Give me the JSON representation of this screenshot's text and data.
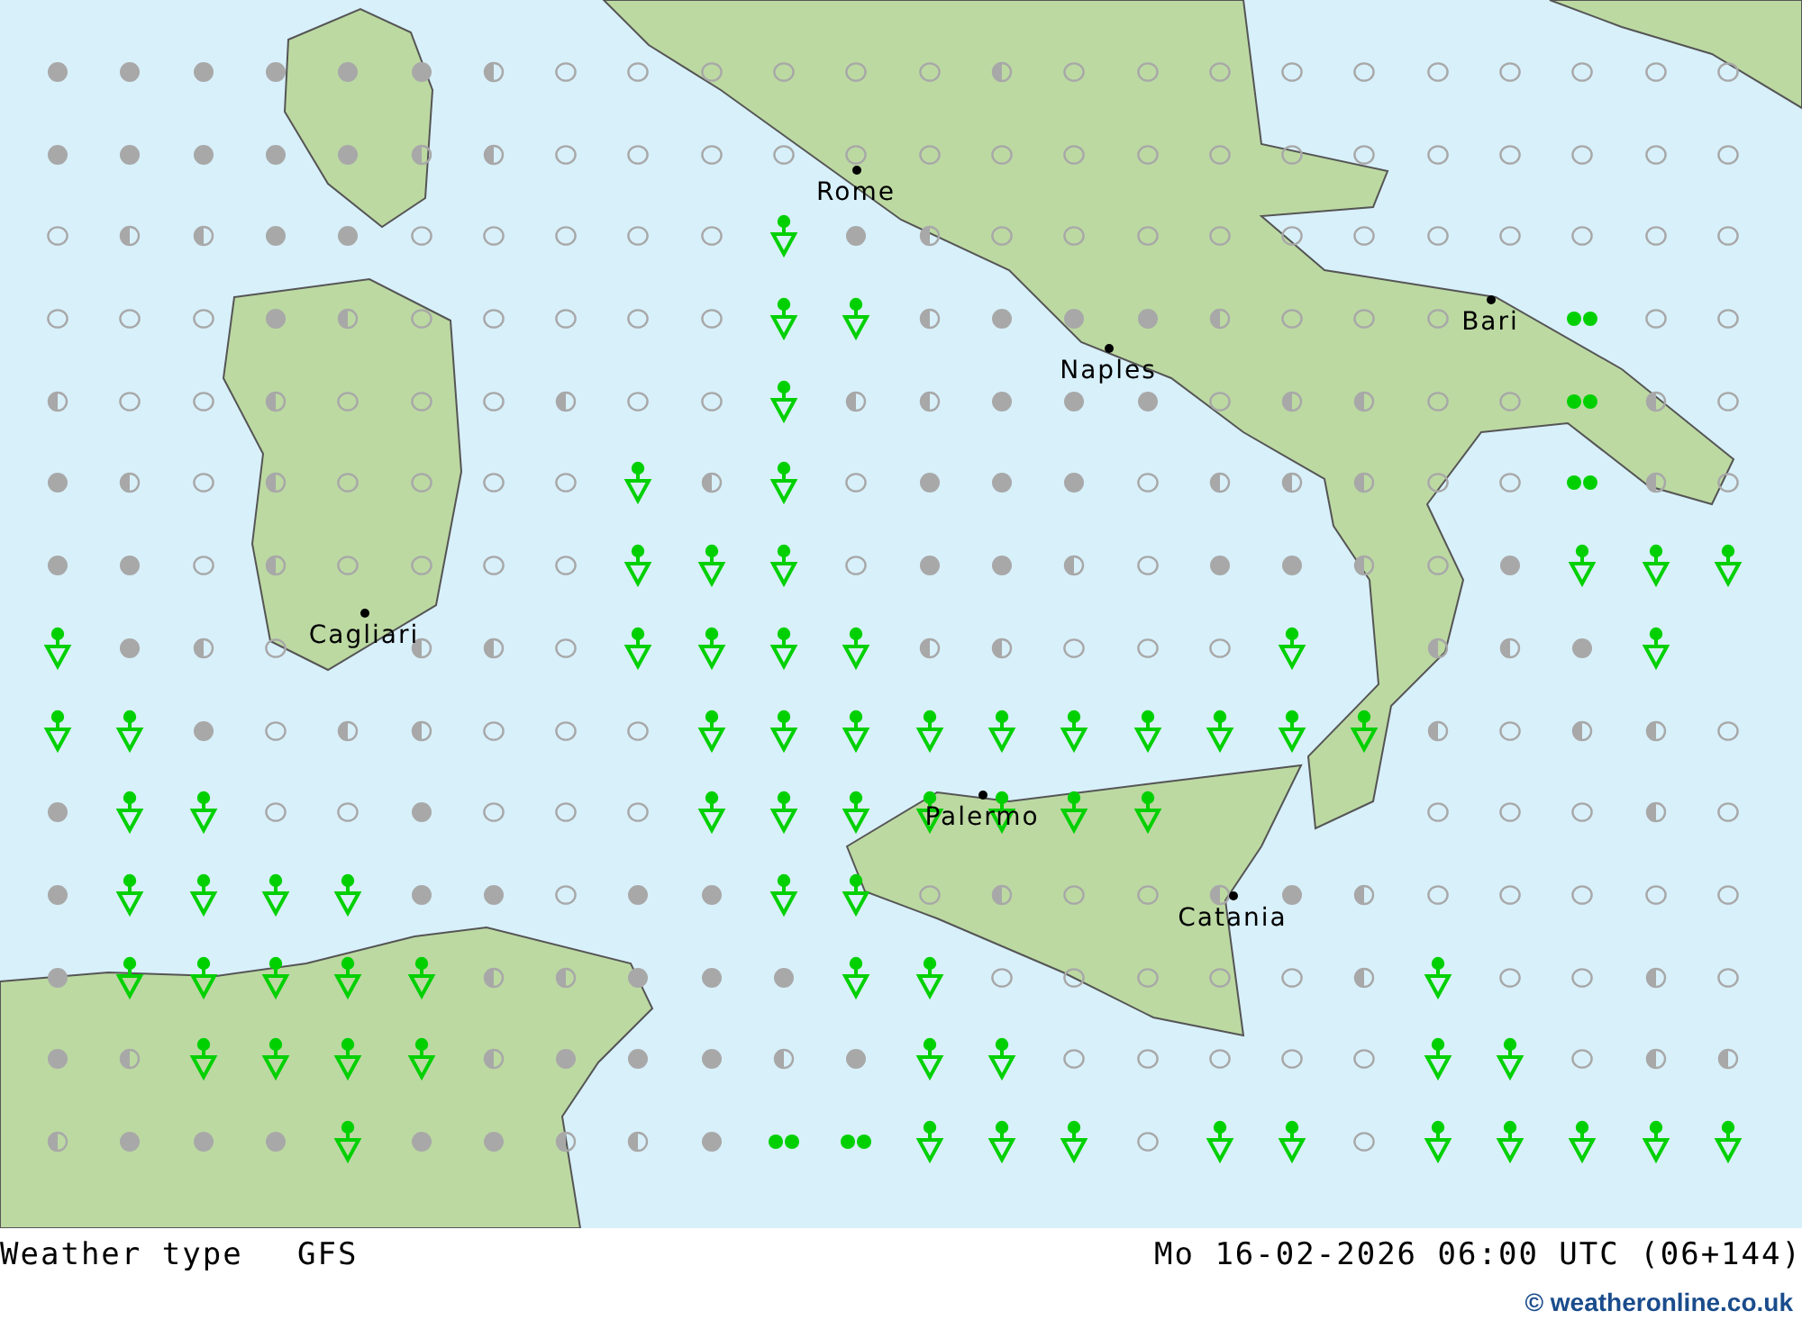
{
  "map": {
    "cities": [
      {
        "name": "Rome"
      },
      {
        "name": "Naples"
      },
      {
        "name": "Bari"
      },
      {
        "name": "Cagliari"
      },
      {
        "name": "Palermo"
      },
      {
        "name": "Catania"
      }
    ]
  },
  "weather_grid": {
    "rows": [
      {
        "cells": [
          {
            "kind": "full"
          },
          {
            "kind": "full"
          },
          {
            "kind": "full"
          },
          {
            "kind": "full"
          },
          {
            "kind": "full"
          },
          {
            "kind": "full"
          },
          {
            "kind": "half"
          },
          {
            "kind": "empty"
          },
          {
            "kind": "empty"
          },
          {
            "kind": "empty"
          },
          {
            "kind": "empty"
          },
          {
            "kind": "empty"
          },
          {
            "kind": "empty"
          },
          {
            "kind": "half"
          },
          {
            "kind": "empty"
          },
          {
            "kind": "empty"
          },
          {
            "kind": "empty"
          },
          {
            "kind": "empty"
          },
          {
            "kind": "empty"
          },
          {
            "kind": "empty"
          },
          {
            "kind": "empty"
          },
          {
            "kind": "empty"
          },
          {
            "kind": "empty"
          },
          {
            "kind": "empty"
          }
        ]
      },
      {
        "cells": [
          {
            "kind": "full"
          },
          {
            "kind": "full"
          },
          {
            "kind": "full"
          },
          {
            "kind": "full"
          },
          {
            "kind": "full"
          },
          {
            "kind": "half"
          },
          {
            "kind": "half"
          },
          {
            "kind": "empty"
          },
          {
            "kind": "empty"
          },
          {
            "kind": "empty"
          },
          {
            "kind": "empty"
          },
          {
            "kind": "empty"
          },
          {
            "kind": "empty"
          },
          {
            "kind": "empty"
          },
          {
            "kind": "empty"
          },
          {
            "kind": "empty"
          },
          {
            "kind": "empty"
          },
          {
            "kind": "empty"
          },
          {
            "kind": "empty"
          },
          {
            "kind": "empty"
          },
          {
            "kind": "empty"
          },
          {
            "kind": "empty"
          },
          {
            "kind": "empty"
          },
          {
            "kind": "empty"
          }
        ]
      },
      {
        "cells": [
          {
            "kind": "empty"
          },
          {
            "kind": "half"
          },
          {
            "kind": "half"
          },
          {
            "kind": "full"
          },
          {
            "kind": "full"
          },
          {
            "kind": "empty"
          },
          {
            "kind": "empty"
          },
          {
            "kind": "empty"
          },
          {
            "kind": "empty"
          },
          {
            "kind": "empty"
          },
          {
            "kind": "shower"
          },
          {
            "kind": "full"
          },
          {
            "kind": "half"
          },
          {
            "kind": "empty"
          },
          {
            "kind": "empty"
          },
          {
            "kind": "empty"
          },
          {
            "kind": "empty"
          },
          {
            "kind": "empty"
          },
          {
            "kind": "empty"
          },
          {
            "kind": "empty"
          },
          {
            "kind": "empty"
          },
          {
            "kind": "empty"
          },
          {
            "kind": "empty"
          },
          {
            "kind": "empty"
          }
        ]
      },
      {
        "cells": [
          {
            "kind": "empty"
          },
          {
            "kind": "empty"
          },
          {
            "kind": "empty"
          },
          {
            "kind": "full"
          },
          {
            "kind": "half"
          },
          {
            "kind": "empty"
          },
          {
            "kind": "empty"
          },
          {
            "kind": "empty"
          },
          {
            "kind": "empty"
          },
          {
            "kind": "empty"
          },
          {
            "kind": "shower"
          },
          {
            "kind": "shower"
          },
          {
            "kind": "half"
          },
          {
            "kind": "full"
          },
          {
            "kind": "full"
          },
          {
            "kind": "full"
          },
          {
            "kind": "half"
          },
          {
            "kind": "empty"
          },
          {
            "kind": "empty"
          },
          {
            "kind": "empty"
          },
          {
            "kind": "none"
          },
          {
            "kind": "drizzle"
          },
          {
            "kind": "empty"
          },
          {
            "kind": "empty"
          }
        ]
      },
      {
        "cells": [
          {
            "kind": "half"
          },
          {
            "kind": "empty"
          },
          {
            "kind": "empty"
          },
          {
            "kind": "half"
          },
          {
            "kind": "empty"
          },
          {
            "kind": "empty"
          },
          {
            "kind": "empty"
          },
          {
            "kind": "half"
          },
          {
            "kind": "empty"
          },
          {
            "kind": "empty"
          },
          {
            "kind": "shower"
          },
          {
            "kind": "half"
          },
          {
            "kind": "half"
          },
          {
            "kind": "full"
          },
          {
            "kind": "full"
          },
          {
            "kind": "full"
          },
          {
            "kind": "empty"
          },
          {
            "kind": "half"
          },
          {
            "kind": "half"
          },
          {
            "kind": "empty"
          },
          {
            "kind": "empty"
          },
          {
            "kind": "drizzle"
          },
          {
            "kind": "half"
          },
          {
            "kind": "empty"
          }
        ]
      },
      {
        "cells": [
          {
            "kind": "full"
          },
          {
            "kind": "half"
          },
          {
            "kind": "empty"
          },
          {
            "kind": "half"
          },
          {
            "kind": "empty"
          },
          {
            "kind": "empty"
          },
          {
            "kind": "empty"
          },
          {
            "kind": "empty"
          },
          {
            "kind": "shower"
          },
          {
            "kind": "half"
          },
          {
            "kind": "shower"
          },
          {
            "kind": "empty"
          },
          {
            "kind": "full"
          },
          {
            "kind": "full"
          },
          {
            "kind": "full"
          },
          {
            "kind": "empty"
          },
          {
            "kind": "half"
          },
          {
            "kind": "half"
          },
          {
            "kind": "half"
          },
          {
            "kind": "empty"
          },
          {
            "kind": "empty"
          },
          {
            "kind": "drizzle"
          },
          {
            "kind": "half"
          },
          {
            "kind": "empty"
          }
        ]
      },
      {
        "cells": [
          {
            "kind": "full"
          },
          {
            "kind": "full"
          },
          {
            "kind": "empty"
          },
          {
            "kind": "half"
          },
          {
            "kind": "empty"
          },
          {
            "kind": "empty"
          },
          {
            "kind": "empty"
          },
          {
            "kind": "empty"
          },
          {
            "kind": "shower"
          },
          {
            "kind": "shower"
          },
          {
            "kind": "shower"
          },
          {
            "kind": "empty"
          },
          {
            "kind": "full"
          },
          {
            "kind": "full"
          },
          {
            "kind": "half"
          },
          {
            "kind": "empty"
          },
          {
            "kind": "full"
          },
          {
            "kind": "full"
          },
          {
            "kind": "half"
          },
          {
            "kind": "empty"
          },
          {
            "kind": "full"
          },
          {
            "kind": "shower"
          },
          {
            "kind": "shower"
          },
          {
            "kind": "shower"
          }
        ]
      },
      {
        "cells": [
          {
            "kind": "shower"
          },
          {
            "kind": "full"
          },
          {
            "kind": "half"
          },
          {
            "kind": "empty"
          },
          {
            "kind": "none"
          },
          {
            "kind": "half"
          },
          {
            "kind": "half"
          },
          {
            "kind": "empty"
          },
          {
            "kind": "shower"
          },
          {
            "kind": "shower"
          },
          {
            "kind": "shower"
          },
          {
            "kind": "shower"
          },
          {
            "kind": "half"
          },
          {
            "kind": "half"
          },
          {
            "kind": "empty"
          },
          {
            "kind": "empty"
          },
          {
            "kind": "empty"
          },
          {
            "kind": "shower"
          },
          {
            "kind": "none"
          },
          {
            "kind": "half"
          },
          {
            "kind": "half"
          },
          {
            "kind": "full"
          },
          {
            "kind": "shower"
          },
          {
            "kind": "none"
          }
        ]
      },
      {
        "cells": [
          {
            "kind": "shower"
          },
          {
            "kind": "shower"
          },
          {
            "kind": "full"
          },
          {
            "kind": "empty"
          },
          {
            "kind": "half"
          },
          {
            "kind": "half"
          },
          {
            "kind": "empty"
          },
          {
            "kind": "empty"
          },
          {
            "kind": "empty"
          },
          {
            "kind": "shower"
          },
          {
            "kind": "shower"
          },
          {
            "kind": "shower"
          },
          {
            "kind": "shower"
          },
          {
            "kind": "shower"
          },
          {
            "kind": "shower"
          },
          {
            "kind": "shower"
          },
          {
            "kind": "shower"
          },
          {
            "kind": "shower"
          },
          {
            "kind": "shower"
          },
          {
            "kind": "half"
          },
          {
            "kind": "empty"
          },
          {
            "kind": "half"
          },
          {
            "kind": "half"
          },
          {
            "kind": "empty"
          }
        ]
      },
      {
        "cells": [
          {
            "kind": "full"
          },
          {
            "kind": "shower"
          },
          {
            "kind": "shower"
          },
          {
            "kind": "empty"
          },
          {
            "kind": "empty"
          },
          {
            "kind": "full"
          },
          {
            "kind": "empty"
          },
          {
            "kind": "empty"
          },
          {
            "kind": "empty"
          },
          {
            "kind": "shower"
          },
          {
            "kind": "shower"
          },
          {
            "kind": "shower"
          },
          {
            "kind": "shower"
          },
          {
            "kind": "shower"
          },
          {
            "kind": "shower"
          },
          {
            "kind": "shower"
          },
          {
            "kind": "none"
          },
          {
            "kind": "none"
          },
          {
            "kind": "none"
          },
          {
            "kind": "empty"
          },
          {
            "kind": "empty"
          },
          {
            "kind": "empty"
          },
          {
            "kind": "half"
          },
          {
            "kind": "empty"
          }
        ]
      },
      {
        "cells": [
          {
            "kind": "full"
          },
          {
            "kind": "shower"
          },
          {
            "kind": "shower"
          },
          {
            "kind": "shower"
          },
          {
            "kind": "shower"
          },
          {
            "kind": "full"
          },
          {
            "kind": "full"
          },
          {
            "kind": "empty"
          },
          {
            "kind": "full"
          },
          {
            "kind": "full"
          },
          {
            "kind": "shower"
          },
          {
            "kind": "shower"
          },
          {
            "kind": "empty"
          },
          {
            "kind": "half"
          },
          {
            "kind": "empty"
          },
          {
            "kind": "empty"
          },
          {
            "kind": "half"
          },
          {
            "kind": "full"
          },
          {
            "kind": "half"
          },
          {
            "kind": "empty"
          },
          {
            "kind": "empty"
          },
          {
            "kind": "empty"
          },
          {
            "kind": "empty"
          },
          {
            "kind": "empty"
          }
        ]
      },
      {
        "cells": [
          {
            "kind": "full"
          },
          {
            "kind": "shower"
          },
          {
            "kind": "shower"
          },
          {
            "kind": "shower"
          },
          {
            "kind": "shower"
          },
          {
            "kind": "shower"
          },
          {
            "kind": "half"
          },
          {
            "kind": "half"
          },
          {
            "kind": "full"
          },
          {
            "kind": "full"
          },
          {
            "kind": "full"
          },
          {
            "kind": "shower"
          },
          {
            "kind": "shower"
          },
          {
            "kind": "empty"
          },
          {
            "kind": "empty"
          },
          {
            "kind": "empty"
          },
          {
            "kind": "empty"
          },
          {
            "kind": "empty"
          },
          {
            "kind": "half"
          },
          {
            "kind": "shower"
          },
          {
            "kind": "empty"
          },
          {
            "kind": "empty"
          },
          {
            "kind": "half"
          },
          {
            "kind": "empty"
          }
        ]
      },
      {
        "cells": [
          {
            "kind": "full"
          },
          {
            "kind": "half"
          },
          {
            "kind": "shower"
          },
          {
            "kind": "shower"
          },
          {
            "kind": "shower"
          },
          {
            "kind": "shower"
          },
          {
            "kind": "half"
          },
          {
            "kind": "full"
          },
          {
            "kind": "full"
          },
          {
            "kind": "full"
          },
          {
            "kind": "half"
          },
          {
            "kind": "full"
          },
          {
            "kind": "shower"
          },
          {
            "kind": "shower"
          },
          {
            "kind": "empty"
          },
          {
            "kind": "empty"
          },
          {
            "kind": "empty"
          },
          {
            "kind": "empty"
          },
          {
            "kind": "empty"
          },
          {
            "kind": "shower"
          },
          {
            "kind": "shower"
          },
          {
            "kind": "empty"
          },
          {
            "kind": "half"
          },
          {
            "kind": "half"
          }
        ]
      },
      {
        "cells": [
          {
            "kind": "half"
          },
          {
            "kind": "full"
          },
          {
            "kind": "full"
          },
          {
            "kind": "full"
          },
          {
            "kind": "shower"
          },
          {
            "kind": "full"
          },
          {
            "kind": "full"
          },
          {
            "kind": "half"
          },
          {
            "kind": "half"
          },
          {
            "kind": "full"
          },
          {
            "kind": "drizzle"
          },
          {
            "kind": "drizzle"
          },
          {
            "kind": "shower"
          },
          {
            "kind": "shower"
          },
          {
            "kind": "shower"
          },
          {
            "kind": "empty"
          },
          {
            "kind": "shower"
          },
          {
            "kind": "shower"
          },
          {
            "kind": "empty"
          },
          {
            "kind": "shower"
          },
          {
            "kind": "shower"
          },
          {
            "kind": "shower"
          },
          {
            "kind": "shower"
          },
          {
            "kind": "shower"
          }
        ]
      }
    ]
  },
  "footer": {
    "title": "Weather type",
    "model": "GFS",
    "datetime": "Mo 16-02-2026 06:00 UTC (06+144)",
    "credit": "© weatheronline.co.uk"
  }
}
